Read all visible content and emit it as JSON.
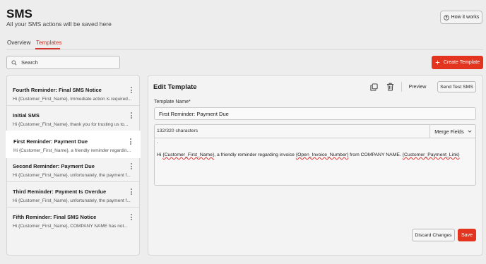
{
  "header": {
    "title": "SMS",
    "subtitle": "All your SMS actions will be saved here",
    "how_it_works": "How it works"
  },
  "tabs": [
    {
      "label": "Overview",
      "active": false
    },
    {
      "label": "Templates",
      "active": true
    }
  ],
  "search": {
    "placeholder": "Search",
    "value": ""
  },
  "create_button": "Create Template",
  "templates": [
    {
      "title": "Fourth Reminder: Final SMS Notice",
      "preview": "Hi {Customer_First_Name}, Immediate action is required...",
      "selected": false
    },
    {
      "title": "Initial SMS",
      "preview": "Hi {Customer_First_Name}, thank you for trusting us to...",
      "selected": false
    },
    {
      "title": "First Reminder: Payment Due",
      "preview": "Hi {Customer_First_Name}, a friendly reminder regardin...",
      "selected": true
    },
    {
      "title": "Second Reminder: Payment Due",
      "preview": "Hi {Customer_First_Name}, unfortunately, the payment f...",
      "selected": false
    },
    {
      "title": "Third Reminder: Payment Is Overdue",
      "preview": "Hi {Customer_First_Name}, unfortunately, the payment f...",
      "selected": false
    },
    {
      "title": "Fifth Reminder: Final SMS Notice",
      "preview": "Hi {Customer_First_Name}, COMPANY NAME has not...",
      "selected": false
    }
  ],
  "editor": {
    "title": "Edit Template",
    "preview_label": "Preview",
    "send_test_label": "Send Test SMS",
    "name_label": "Template Name*",
    "name_value": "First Reminder: Payment Due",
    "char_count": "132/320 characters",
    "merge_fields_label": "Merge Fields",
    "cursor_mark": "'",
    "message": {
      "part1": "Hi ",
      "var1": "{Customer_First_Name}",
      "part2": ", a friendly reminder regarding invoice ",
      "var2": "{Open_Invoice_Number}",
      "part3": " from COMPANY NAME. ",
      "var3": "{Customer_Payment_Link}"
    },
    "discard_label": "Discard Changes",
    "save_label": "Save"
  },
  "icons": {
    "help": "question-circle-icon",
    "plus": "plus-icon",
    "search": "search-icon",
    "kebab": "kebab-menu-icon",
    "copy": "copy-icon",
    "trash": "trash-icon",
    "chevron": "chevron-down-icon"
  },
  "colors": {
    "accent": "#e2341f",
    "active_tab": "#c7362a",
    "background": "#ededed",
    "panel": "#f3f3f3"
  }
}
